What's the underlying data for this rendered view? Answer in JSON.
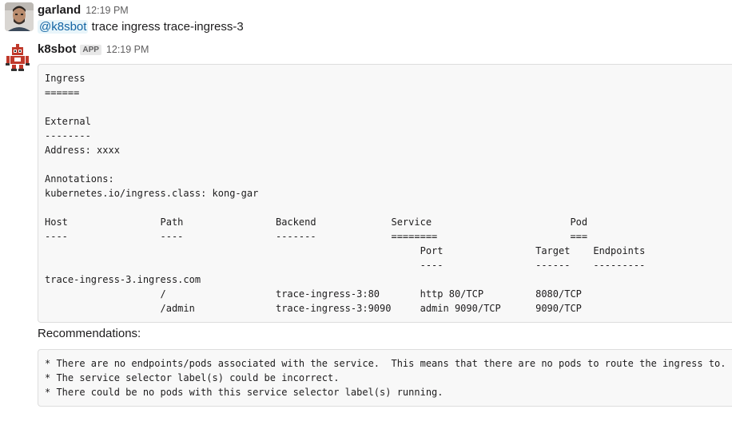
{
  "messages": [
    {
      "sender": "garland",
      "time": "12:19 PM",
      "mention": "@k8sbot",
      "text": " trace ingress trace-ingress-3"
    },
    {
      "sender": "k8sbot",
      "badge": "APP",
      "time": "12:19 PM",
      "code_block": "Ingress\n======\n\nExternal\n--------\nAddress: xxxx\n\nAnnotations:\nkubernetes.io/ingress.class: kong-gar\n\nHost                Path                Backend             Service                        Pod\n----                ----                -------             ========                       ===\n                                                                 Port                Target    Endpoints\n                                                                 ----                ------    ---------\ntrace-ingress-3.ingress.com\n                    /                   trace-ingress-3:80       http 80/TCP         8080/TCP\n                    /admin              trace-ingress-3:9090     admin 9090/TCP      9090/TCP",
      "recommendations_label": "Recommendations:",
      "recommendations": "* There are no endpoints/pods associated with the service.  This means that there are no pods to route the ingress to.\n* The service selector label(s) could be incorrect.\n* There could be no pods with this service selector label(s) running."
    }
  ],
  "colors": {
    "mention_text": "#1264a3",
    "mention_bg": "#e8f5fa",
    "code_bg": "#f8f8f8",
    "code_border": "#dddddd",
    "bot_red": "#c0392b"
  },
  "icons": {
    "user_avatar": "user-photo-avatar",
    "bot_avatar": "robot-avatar"
  }
}
